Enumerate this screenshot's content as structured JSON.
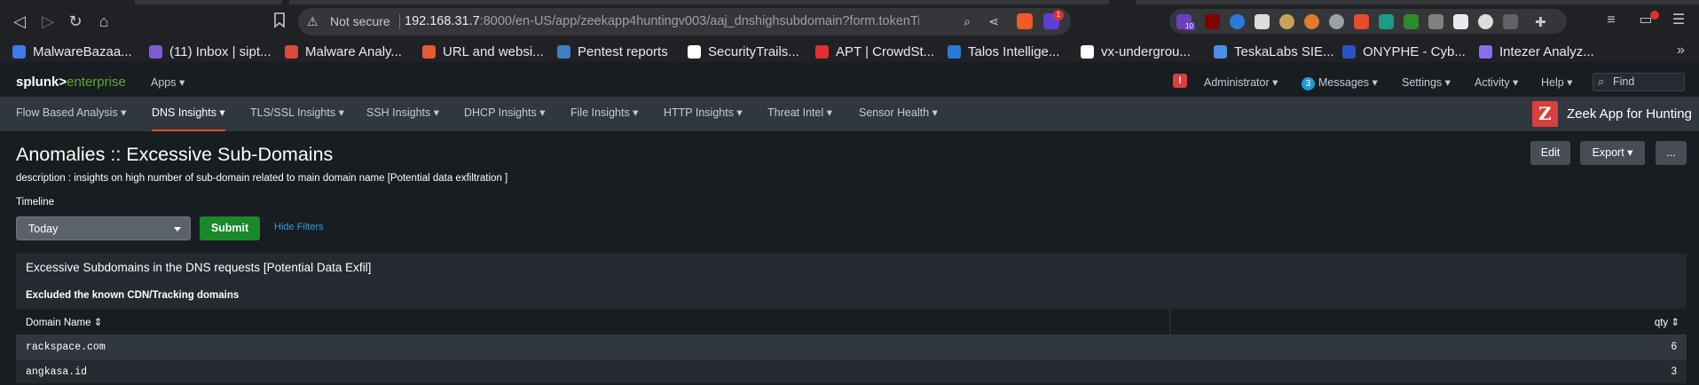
{
  "browser": {
    "security_label": "Not secure",
    "url_host": "192.168.31.7",
    "url_path": ":8000/en-US/app/zeekapp4huntingv003/aaj_dnshighsubdomain?form.tokenTimelin...",
    "extension_badge_count": "10",
    "brave_badge_count": "1"
  },
  "bookmarks": [
    {
      "label": "MalwareBazaa...",
      "color": "#3f7ae8"
    },
    {
      "label": "(11) Inbox | sipt...",
      "color": "#7b5cd6"
    },
    {
      "label": "Malware Analy...",
      "color": "#d94a3b"
    },
    {
      "label": "URL and websi...",
      "color": "#e25b33"
    },
    {
      "label": "Pentest reports",
      "color": "#3c7fc2"
    },
    {
      "label": "SecurityTrails...",
      "color": "#ffffff"
    },
    {
      "label": "APT | CrowdSt...",
      "color": "#e0302e"
    },
    {
      "label": "Talos Intellige...",
      "color": "#2a7ad8"
    },
    {
      "label": "vx-undergrou...",
      "color": "#ffffff"
    },
    {
      "label": "TeskaLabs SIE...",
      "color": "#4b8ee3"
    },
    {
      "label": "ONYPHE - Cyb...",
      "color": "#2d52c8"
    },
    {
      "label": "Intezer Analyz...",
      "color": "#8a6cf0"
    }
  ],
  "splunk": {
    "logo_main": "splunk>",
    "logo_sub": "enterprise",
    "apps_label": "Apps ▾",
    "alert_icon": "!",
    "user_menu": "Administrator ▾",
    "messages_count": "3",
    "messages_label": "Messages ▾",
    "settings_label": "Settings ▾",
    "activity_label": "Activity ▾",
    "help_label": "Help ▾",
    "find_placeholder": "Find"
  },
  "app_nav": {
    "tabs": [
      {
        "label": "Flow Based Analysis ▾"
      },
      {
        "label": "DNS Insights ▾"
      },
      {
        "label": "TLS/SSL Insights ▾"
      },
      {
        "label": "SSH Insights ▾"
      },
      {
        "label": "DHCP Insights ▾"
      },
      {
        "label": "File Insights ▾"
      },
      {
        "label": "HTTP Insights ▾"
      },
      {
        "label": "Threat Intel ▾"
      },
      {
        "label": "Sensor Health ▾"
      }
    ],
    "active_tab": "DNS Insights",
    "app_title": "Zeek App for Hunting"
  },
  "dashboard": {
    "title": "Anomalies :: Excessive Sub-Domains",
    "description": "description : insights on high number of sub-domain related to main domain name [Potential data exfiltration ]",
    "edit_label": "Edit",
    "export_label": "Export ▾",
    "more_label": "...",
    "timeline_label": "Timeline",
    "timeline_value": "Today",
    "submit_label": "Submit",
    "hide_filters_label": "Hide Filters"
  },
  "panel": {
    "title": "Excessive Subdomains in the DNS requests [Potential Data Exfil]",
    "subtitle": "Excluded the known CDN/Tracking domains",
    "columns": [
      "Domain Name ⇕",
      "qty ⇕"
    ],
    "rows": [
      {
        "domain": "rackspace.com",
        "qty": "6"
      },
      {
        "domain": "angkasa.id",
        "qty": "3"
      }
    ]
  }
}
